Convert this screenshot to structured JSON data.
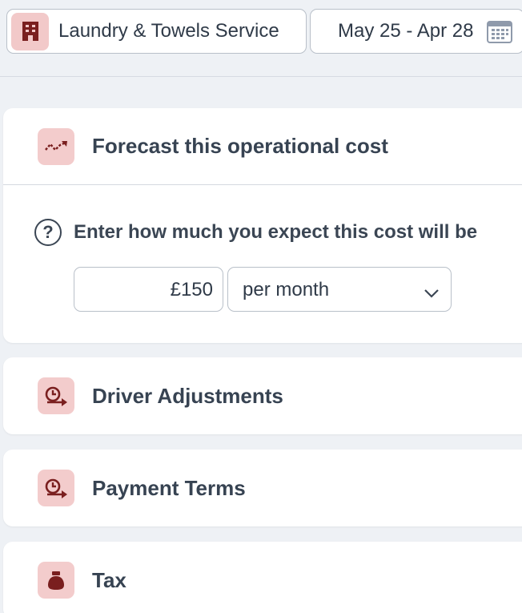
{
  "header": {
    "cost_name": "Laundry & Towels Service",
    "date_range": "May 25 - Apr 28",
    "building_icon": "building-icon",
    "calendar_icon": "calendar-icon"
  },
  "forecast": {
    "title": "Forecast this operational cost",
    "icon": "trend-arrow-icon",
    "question": "Enter how much you expect this cost will be",
    "help_icon_glyph": "?",
    "amount_value": "£150",
    "period_selected": "per month"
  },
  "sections": [
    {
      "title": "Driver Adjustments",
      "icon": "clock-arrow-icon"
    },
    {
      "title": "Payment Terms",
      "icon": "clock-arrow-icon"
    },
    {
      "title": "Tax",
      "icon": "money-bag-icon"
    }
  ],
  "colors": {
    "accent": "#7a1f1f",
    "icon_bg": "#f3cccc",
    "page_bg": "#eef1f5"
  }
}
